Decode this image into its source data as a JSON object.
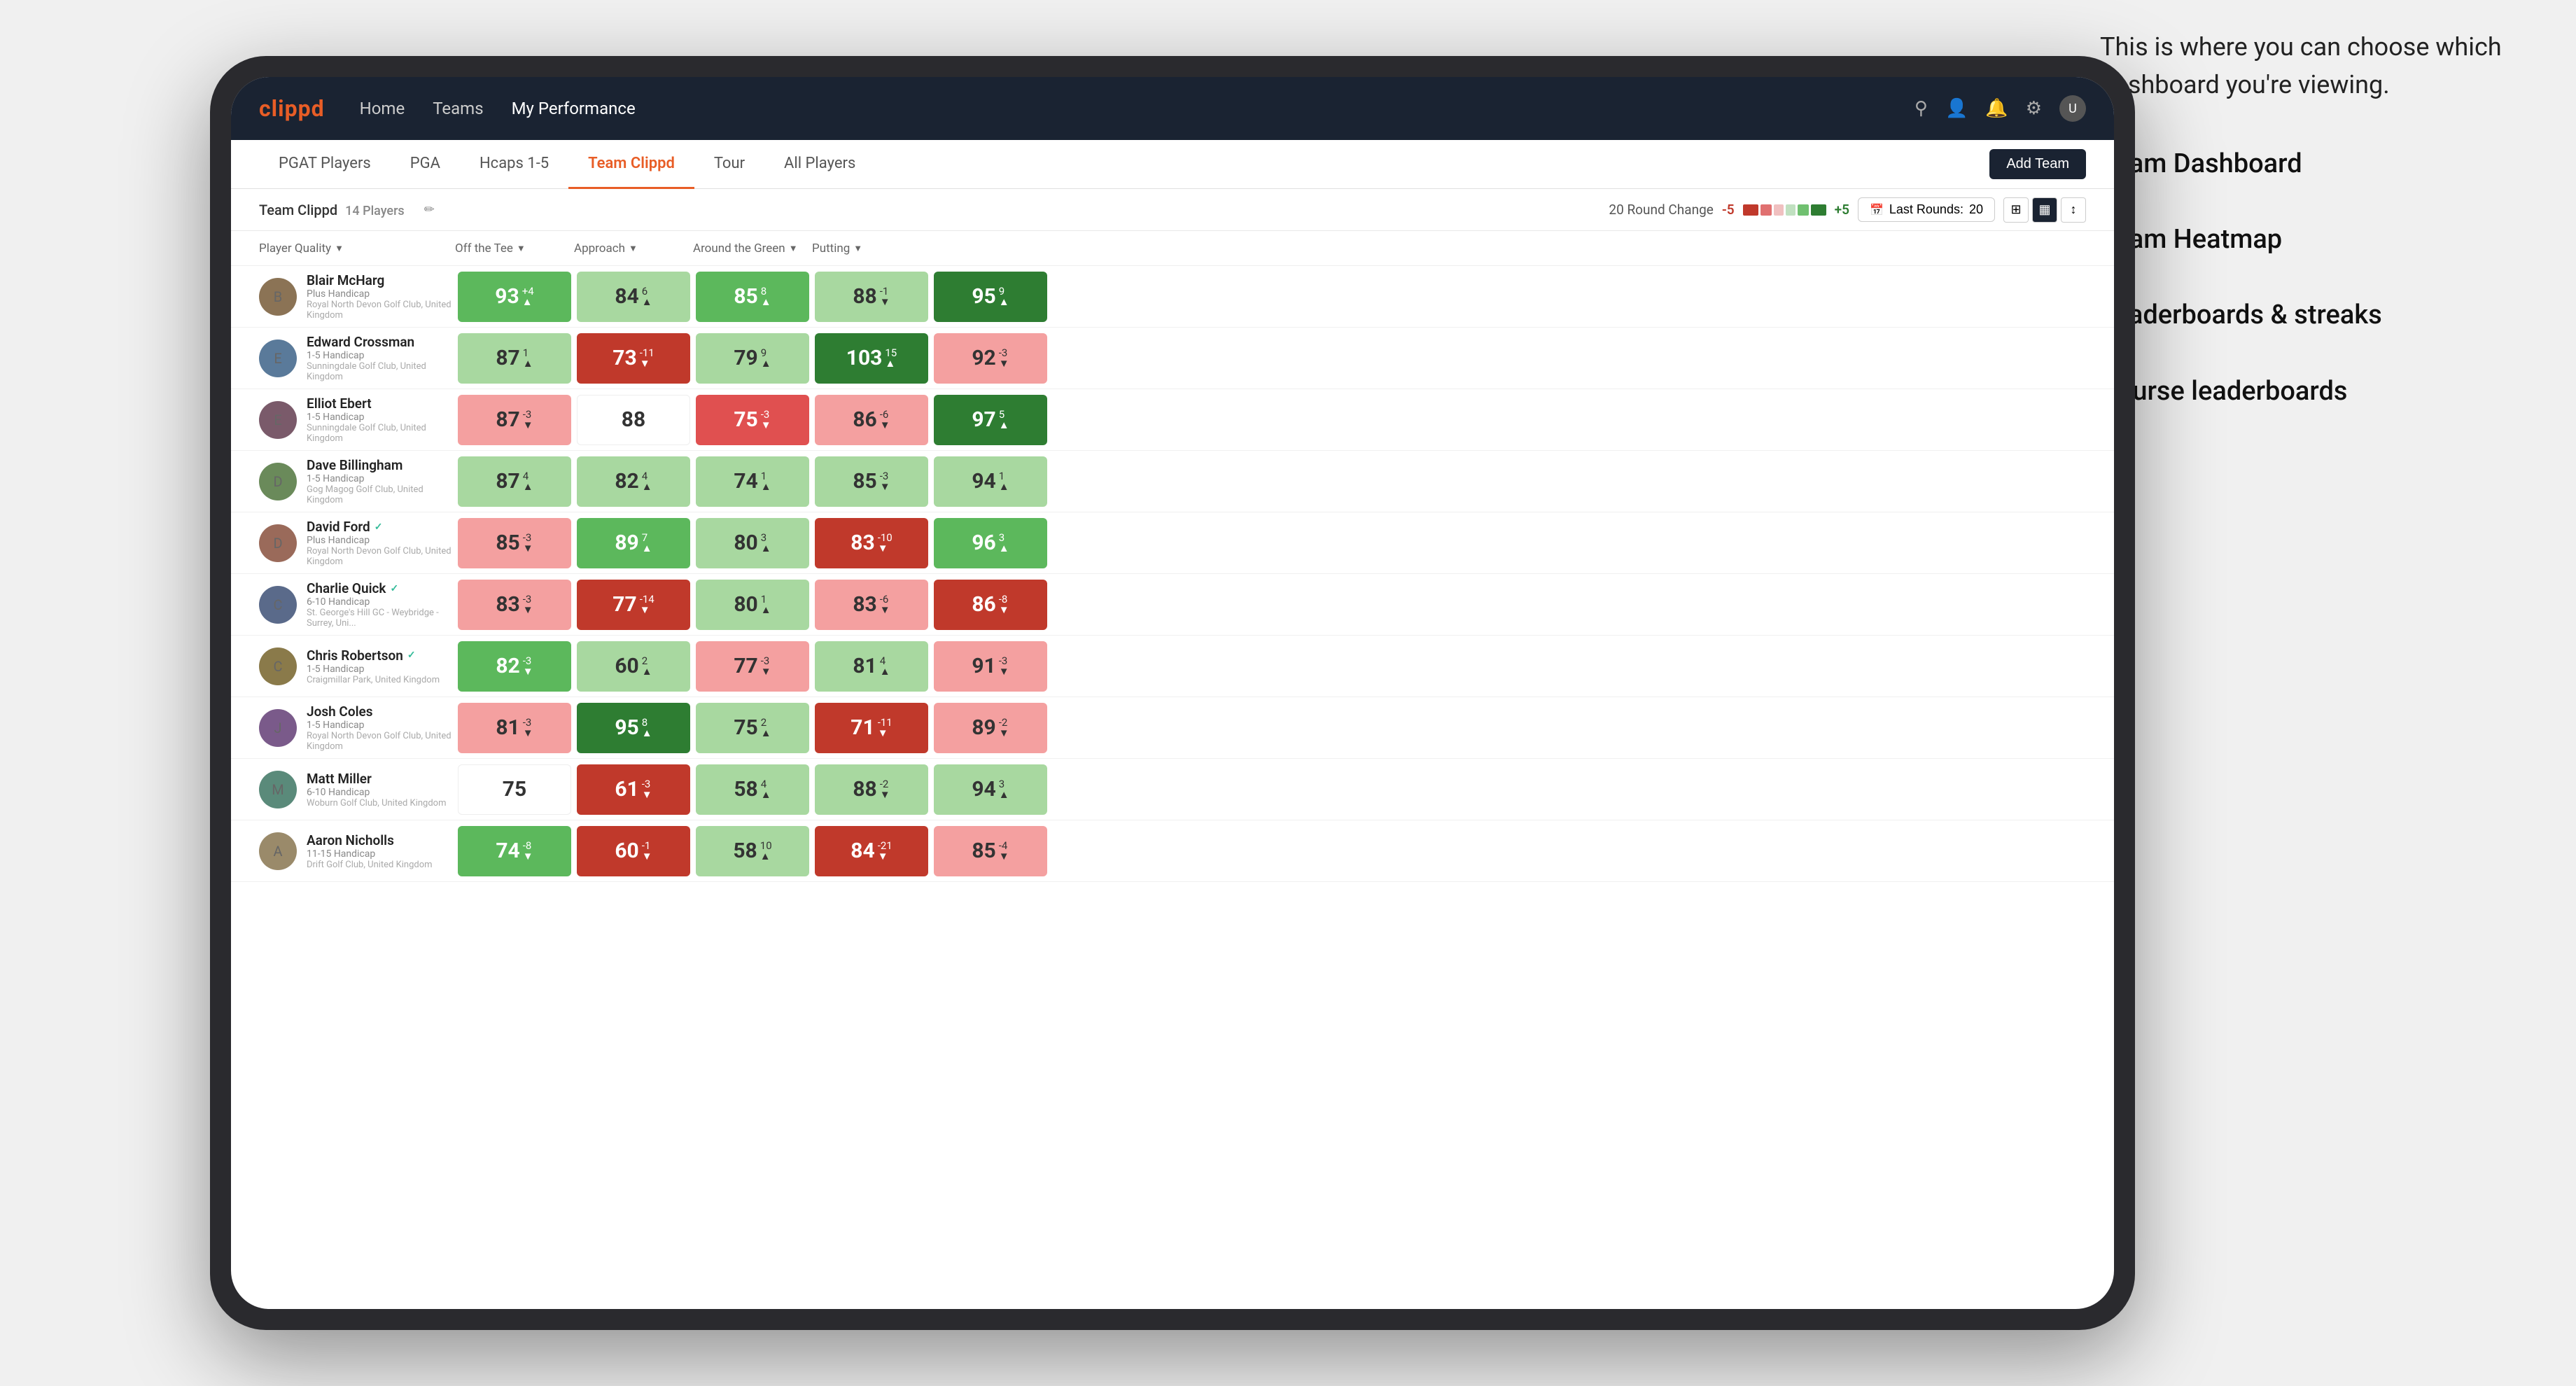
{
  "annotation": {
    "intro": "This is where you can choose which dashboard you're viewing.",
    "items": [
      "Team Dashboard",
      "Team Heatmap",
      "Leaderboards & streaks",
      "Course leaderboards"
    ]
  },
  "nav": {
    "logo": "clippd",
    "links": [
      "Home",
      "Teams",
      "My Performance"
    ],
    "active_link": "My Performance"
  },
  "tabs": {
    "items": [
      "PGAT Players",
      "PGA",
      "Hcaps 1-5",
      "Team Clippd",
      "Tour",
      "All Players"
    ],
    "active": "Team Clippd",
    "add_team_label": "Add Team"
  },
  "toolbar": {
    "team_label": "Team Clippd",
    "player_count": "14 Players",
    "round_change_label": "20 Round Change",
    "minus_val": "-5",
    "plus_val": "+5",
    "last_rounds_label": "Last Rounds:",
    "last_rounds_val": "20"
  },
  "table": {
    "columns": [
      "Player Quality ↓",
      "Off the Tee ↓",
      "Approach ↓",
      "Around the Green ↓",
      "Putting ↓"
    ],
    "players": [
      {
        "name": "Blair McHarg",
        "hcp": "Plus Handicap",
        "club": "Royal North Devon Golf Club, United Kingdom",
        "verified": false,
        "scores": [
          {
            "val": 93,
            "change": "+4",
            "dir": "up",
            "color": "mid-green"
          },
          {
            "val": 84,
            "change": "6",
            "dir": "up",
            "color": "light-green"
          },
          {
            "val": 85,
            "change": "8",
            "dir": "up",
            "color": "mid-green"
          },
          {
            "val": 88,
            "change": "-1",
            "dir": "down",
            "color": "light-green"
          },
          {
            "val": 95,
            "change": "9",
            "dir": "up",
            "color": "dark-green"
          }
        ]
      },
      {
        "name": "Edward Crossman",
        "hcp": "1-5 Handicap",
        "club": "Sunningdale Golf Club, United Kingdom",
        "verified": false,
        "scores": [
          {
            "val": 87,
            "change": "1",
            "dir": "up",
            "color": "light-green"
          },
          {
            "val": 73,
            "change": "-11",
            "dir": "down",
            "color": "dark-red"
          },
          {
            "val": 79,
            "change": "9",
            "dir": "up",
            "color": "light-green"
          },
          {
            "val": 103,
            "change": "15",
            "dir": "up",
            "color": "dark-green"
          },
          {
            "val": 92,
            "change": "-3",
            "dir": "down",
            "color": "light-red"
          }
        ]
      },
      {
        "name": "Elliot Ebert",
        "hcp": "1-5 Handicap",
        "club": "Sunningdale Golf Club, United Kingdom",
        "verified": false,
        "scores": [
          {
            "val": 87,
            "change": "-3",
            "dir": "down",
            "color": "light-red"
          },
          {
            "val": 88,
            "change": "",
            "dir": "",
            "color": "white"
          },
          {
            "val": 75,
            "change": "-3",
            "dir": "down",
            "color": "mid-red"
          },
          {
            "val": 86,
            "change": "-6",
            "dir": "down",
            "color": "light-red"
          },
          {
            "val": 97,
            "change": "5",
            "dir": "up",
            "color": "dark-green"
          }
        ]
      },
      {
        "name": "Dave Billingham",
        "hcp": "1-5 Handicap",
        "club": "Gog Magog Golf Club, United Kingdom",
        "verified": false,
        "scores": [
          {
            "val": 87,
            "change": "4",
            "dir": "up",
            "color": "light-green"
          },
          {
            "val": 82,
            "change": "4",
            "dir": "up",
            "color": "light-green"
          },
          {
            "val": 74,
            "change": "1",
            "dir": "up",
            "color": "light-green"
          },
          {
            "val": 85,
            "change": "-3",
            "dir": "down",
            "color": "light-green"
          },
          {
            "val": 94,
            "change": "1",
            "dir": "up",
            "color": "light-green"
          }
        ]
      },
      {
        "name": "David Ford",
        "hcp": "Plus Handicap",
        "club": "Royal North Devon Golf Club, United Kingdom",
        "verified": true,
        "scores": [
          {
            "val": 85,
            "change": "-3",
            "dir": "down",
            "color": "light-red"
          },
          {
            "val": 89,
            "change": "7",
            "dir": "up",
            "color": "mid-green"
          },
          {
            "val": 80,
            "change": "3",
            "dir": "up",
            "color": "light-green"
          },
          {
            "val": 83,
            "change": "-10",
            "dir": "down",
            "color": "dark-red"
          },
          {
            "val": 96,
            "change": "3",
            "dir": "up",
            "color": "mid-green"
          }
        ]
      },
      {
        "name": "Charlie Quick",
        "hcp": "6-10 Handicap",
        "club": "St. George's Hill GC - Weybridge - Surrey, Uni...",
        "verified": true,
        "scores": [
          {
            "val": 83,
            "change": "-3",
            "dir": "down",
            "color": "light-red"
          },
          {
            "val": 77,
            "change": "-14",
            "dir": "down",
            "color": "dark-red"
          },
          {
            "val": 80,
            "change": "1",
            "dir": "up",
            "color": "light-green"
          },
          {
            "val": 83,
            "change": "-6",
            "dir": "down",
            "color": "light-red"
          },
          {
            "val": 86,
            "change": "-8",
            "dir": "down",
            "color": "dark-red"
          }
        ]
      },
      {
        "name": "Chris Robertson",
        "hcp": "1-5 Handicap",
        "club": "Craigmillar Park, United Kingdom",
        "verified": true,
        "scores": [
          {
            "val": 82,
            "change": "-3",
            "dir": "down",
            "color": "mid-green"
          },
          {
            "val": 60,
            "change": "2",
            "dir": "up",
            "color": "light-green"
          },
          {
            "val": 77,
            "change": "-3",
            "dir": "down",
            "color": "light-red"
          },
          {
            "val": 81,
            "change": "4",
            "dir": "up",
            "color": "light-green"
          },
          {
            "val": 91,
            "change": "-3",
            "dir": "down",
            "color": "light-red"
          }
        ]
      },
      {
        "name": "Josh Coles",
        "hcp": "1-5 Handicap",
        "club": "Royal North Devon Golf Club, United Kingdom",
        "verified": false,
        "scores": [
          {
            "val": 81,
            "change": "-3",
            "dir": "down",
            "color": "light-red"
          },
          {
            "val": 95,
            "change": "8",
            "dir": "up",
            "color": "dark-green"
          },
          {
            "val": 75,
            "change": "2",
            "dir": "up",
            "color": "light-green"
          },
          {
            "val": 71,
            "change": "-11",
            "dir": "down",
            "color": "dark-red"
          },
          {
            "val": 89,
            "change": "-2",
            "dir": "down",
            "color": "light-red"
          }
        ]
      },
      {
        "name": "Matt Miller",
        "hcp": "6-10 Handicap",
        "club": "Woburn Golf Club, United Kingdom",
        "verified": false,
        "scores": [
          {
            "val": 75,
            "change": "",
            "dir": "",
            "color": "white"
          },
          {
            "val": 61,
            "change": "-3",
            "dir": "down",
            "color": "dark-red"
          },
          {
            "val": 58,
            "change": "4",
            "dir": "up",
            "color": "light-green"
          },
          {
            "val": 88,
            "change": "-2",
            "dir": "down",
            "color": "light-green"
          },
          {
            "val": 94,
            "change": "3",
            "dir": "up",
            "color": "light-green"
          }
        ]
      },
      {
        "name": "Aaron Nicholls",
        "hcp": "11-15 Handicap",
        "club": "Drift Golf Club, United Kingdom",
        "verified": false,
        "scores": [
          {
            "val": 74,
            "change": "-8",
            "dir": "down",
            "color": "mid-green"
          },
          {
            "val": 60,
            "change": "-1",
            "dir": "down",
            "color": "dark-red"
          },
          {
            "val": 58,
            "change": "10",
            "dir": "up",
            "color": "light-green"
          },
          {
            "val": 84,
            "change": "-21",
            "dir": "down",
            "color": "dark-red"
          },
          {
            "val": 85,
            "change": "-4",
            "dir": "down",
            "color": "light-red"
          }
        ]
      }
    ]
  }
}
